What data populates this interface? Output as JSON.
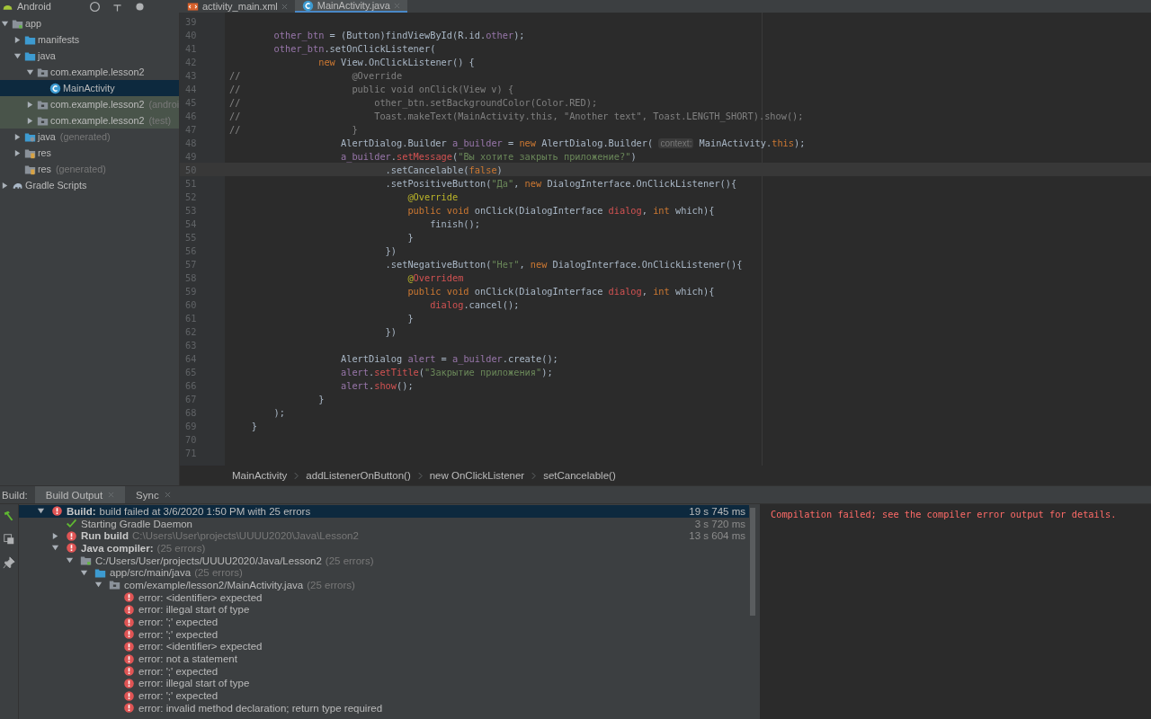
{
  "top_bar": {
    "view_mode": "Android"
  },
  "editor_tabs": [
    {
      "label": "activity_main.xml",
      "kind": "xml",
      "selected": false
    },
    {
      "label": "MainActivity.java",
      "kind": "class",
      "selected": true
    }
  ],
  "project_tree": [
    {
      "label": "app",
      "kind": "module",
      "expanded": true,
      "highlighted": false,
      "selected": false,
      "children": [
        {
          "label": "manifests",
          "kind": "folder",
          "expanded": false,
          "highlighted": false,
          "selected": false
        },
        {
          "label": "java",
          "kind": "folder",
          "expanded": true,
          "highlighted": false,
          "selected": false,
          "children": [
            {
              "label": "com.example.lesson2",
              "kind": "package",
              "expanded": true,
              "highlighted": false,
              "selected": false,
              "children": [
                {
                  "label": "MainActivity",
                  "kind": "class",
                  "highlighted": false,
                  "selected": true
                }
              ]
            },
            {
              "label": "com.example.lesson2",
              "note": "(androi",
              "kind": "package",
              "expanded": false,
              "highlighted": true,
              "selected": false
            },
            {
              "label": "com.example.lesson2",
              "note": "(test)",
              "kind": "package",
              "expanded": false,
              "highlighted": true,
              "selected": false
            }
          ]
        },
        {
          "label": "java",
          "note": "(generated)",
          "kind": "generated",
          "expanded": false,
          "highlighted": false,
          "selected": false
        },
        {
          "label": "res",
          "kind": "res",
          "expanded": false,
          "highlighted": false,
          "selected": false
        },
        {
          "label": "res",
          "note": "(generated)",
          "kind": "res",
          "highlighted": false,
          "selected": false
        }
      ]
    },
    {
      "label": "Gradle Scripts",
      "kind": "gradle",
      "expanded": false,
      "highlighted": false,
      "selected": false
    }
  ],
  "code_lines": [
    {
      "n": "39",
      "current": false
    },
    {
      "n": "40",
      "current": false,
      "tokens": [
        {
          "kind": "field",
          "text": "        other_btn"
        },
        {
          "kind": "plain",
          "text": " = (Button)findViewById(R.id."
        },
        {
          "kind": "field",
          "text": "other"
        },
        {
          "kind": "plain",
          "text": ");"
        }
      ]
    },
    {
      "n": "41",
      "current": false,
      "tokens": [
        {
          "kind": "field",
          "text": "        other_btn"
        },
        {
          "kind": "plain",
          "text": ".setOnClickListener("
        }
      ]
    },
    {
      "n": "42",
      "current": false,
      "tokens": [
        {
          "kind": "keyword",
          "text": "                new"
        },
        {
          "kind": "plain",
          "text": " View.OnClickListener() {"
        }
      ]
    },
    {
      "n": "43",
      "current": false,
      "tokens": [
        {
          "kind": "comment",
          "text": "//                    @Override"
        }
      ]
    },
    {
      "n": "44",
      "current": false,
      "tokens": [
        {
          "kind": "comment",
          "text": "//                    public void onClick(View v) {"
        }
      ]
    },
    {
      "n": "45",
      "current": false,
      "tokens": [
        {
          "kind": "comment",
          "text": "//                        other_btn.setBackgroundColor(Color.RED);"
        }
      ]
    },
    {
      "n": "46",
      "current": false,
      "tokens": [
        {
          "kind": "comment",
          "text": "//                        Toast.makeText(MainActivity.this, \"Another text\", Toast.LENGTH_SHORT).show();"
        }
      ]
    },
    {
      "n": "47",
      "current": false,
      "tokens": [
        {
          "kind": "comment",
          "text": "//                    }"
        }
      ]
    },
    {
      "n": "48",
      "current": false,
      "tokens": [
        {
          "kind": "plain",
          "text": "                    AlertDialog.Builder "
        },
        {
          "kind": "field",
          "text": "a_builder"
        },
        {
          "kind": "plain",
          "text": " = "
        },
        {
          "kind": "keyword",
          "text": "new"
        },
        {
          "kind": "plain",
          "text": " AlertDialog.Builder( "
        },
        {
          "kind": "hint",
          "text": "context:"
        },
        {
          "kind": "plain",
          "text": " MainActivity."
        },
        {
          "kind": "keyword",
          "text": "this"
        },
        {
          "kind": "plain",
          "text": ");"
        }
      ]
    },
    {
      "n": "49",
      "current": false,
      "tokens": [
        {
          "kind": "field",
          "text": "                    a_builder"
        },
        {
          "kind": "plain",
          "text": "."
        },
        {
          "kind": "error",
          "text": "setMessage"
        },
        {
          "kind": "plain",
          "text": "("
        },
        {
          "kind": "string",
          "text": "\"Вы хотите закрыть приложение?\""
        },
        {
          "kind": "plain",
          "text": ")"
        }
      ]
    },
    {
      "n": "50",
      "current": true,
      "tokens": [
        {
          "kind": "plain",
          "text": "                            .setCancelable("
        },
        {
          "kind": "keyword",
          "text": "false"
        },
        {
          "kind": "plain",
          "text": ")"
        }
      ]
    },
    {
      "n": "51",
      "current": false,
      "tokens": [
        {
          "kind": "plain",
          "text": "                            .setPositiveButton("
        },
        {
          "kind": "string",
          "text": "\"Да\""
        },
        {
          "kind": "plain",
          "text": ", "
        },
        {
          "kind": "keyword",
          "text": "new"
        },
        {
          "kind": "plain",
          "text": " DialogInterface.OnClickListener(){"
        }
      ]
    },
    {
      "n": "52",
      "current": false,
      "tokens": [
        {
          "kind": "annotation",
          "text": "                                @Override"
        }
      ]
    },
    {
      "n": "53",
      "current": false,
      "tokens": [
        {
          "kind": "keyword",
          "text": "                                public void"
        },
        {
          "kind": "plain",
          "text": " onClick(DialogInterface "
        },
        {
          "kind": "error",
          "text": "dialog"
        },
        {
          "kind": "plain",
          "text": ", "
        },
        {
          "kind": "keyword",
          "text": "int"
        },
        {
          "kind": "plain",
          "text": " which){"
        }
      ]
    },
    {
      "n": "54",
      "current": false,
      "tokens": [
        {
          "kind": "plain",
          "text": "                                    finish();"
        }
      ]
    },
    {
      "n": "55",
      "current": false,
      "tokens": [
        {
          "kind": "plain",
          "text": "                                }"
        }
      ]
    },
    {
      "n": "56",
      "current": false,
      "tokens": [
        {
          "kind": "plain",
          "text": "                            })"
        }
      ]
    },
    {
      "n": "57",
      "current": false,
      "tokens": [
        {
          "kind": "plain",
          "text": "                            .setNegativeButton("
        },
        {
          "kind": "string",
          "text": "\"Нет\""
        },
        {
          "kind": "plain",
          "text": ", "
        },
        {
          "kind": "keyword",
          "text": "new"
        },
        {
          "kind": "plain",
          "text": " DialogInterface.OnClickListener(){"
        }
      ]
    },
    {
      "n": "58",
      "current": false,
      "tokens": [
        {
          "kind": "annotation",
          "text": "                                @"
        },
        {
          "kind": "error",
          "text": "Overridem"
        }
      ]
    },
    {
      "n": "59",
      "current": false,
      "tokens": [
        {
          "kind": "keyword",
          "text": "                                public void"
        },
        {
          "kind": "plain",
          "text": " onClick(DialogInterface "
        },
        {
          "kind": "error",
          "text": "dialog"
        },
        {
          "kind": "plain",
          "text": ", "
        },
        {
          "kind": "keyword",
          "text": "int"
        },
        {
          "kind": "plain",
          "text": " which){"
        }
      ]
    },
    {
      "n": "60",
      "current": false,
      "tokens": [
        {
          "kind": "error",
          "text": "                                    dialog"
        },
        {
          "kind": "plain",
          "text": ".cancel();"
        }
      ]
    },
    {
      "n": "61",
      "current": false,
      "tokens": [
        {
          "kind": "plain",
          "text": "                                }"
        }
      ]
    },
    {
      "n": "62",
      "current": false,
      "tokens": [
        {
          "kind": "plain",
          "text": "                            })"
        }
      ]
    },
    {
      "n": "63",
      "current": false
    },
    {
      "n": "64",
      "current": false,
      "tokens": [
        {
          "kind": "plain",
          "text": "                    AlertDialog "
        },
        {
          "kind": "field",
          "text": "alert"
        },
        {
          "kind": "plain",
          "text": " = "
        },
        {
          "kind": "field",
          "text": "a_builder"
        },
        {
          "kind": "plain",
          "text": ".create();"
        }
      ]
    },
    {
      "n": "65",
      "current": false,
      "tokens": [
        {
          "kind": "field",
          "text": "                    alert"
        },
        {
          "kind": "plain",
          "text": "."
        },
        {
          "kind": "error",
          "text": "setTitle"
        },
        {
          "kind": "plain",
          "text": "("
        },
        {
          "kind": "string",
          "text": "\"Закрытие приложения\""
        },
        {
          "kind": "plain",
          "text": ");"
        }
      ]
    },
    {
      "n": "66",
      "current": false,
      "tokens": [
        {
          "kind": "field",
          "text": "                    alert"
        },
        {
          "kind": "plain",
          "text": "."
        },
        {
          "kind": "error",
          "text": "show"
        },
        {
          "kind": "plain",
          "text": "();"
        }
      ]
    },
    {
      "n": "67",
      "current": false,
      "tokens": [
        {
          "kind": "plain",
          "text": "                }"
        }
      ]
    },
    {
      "n": "68",
      "current": false,
      "tokens": [
        {
          "kind": "plain",
          "text": "        );"
        }
      ]
    },
    {
      "n": "69",
      "current": false,
      "tokens": [
        {
          "kind": "plain",
          "text": "    }"
        }
      ]
    },
    {
      "n": "70",
      "current": false
    },
    {
      "n": "71",
      "current": false
    }
  ],
  "breadcrumbs": [
    "MainActivity",
    "addListenerOnButton()",
    "new OnClickListener",
    "setCancelable()"
  ],
  "build_panel": {
    "label": "Build:",
    "tabs": [
      {
        "label": "Build Output",
        "selected": true
      },
      {
        "label": "Sync",
        "selected": false
      }
    ],
    "tree": [
      {
        "kind": "error",
        "bold": "Build:",
        "text": "build failed at 3/6/2020 1:50 PM  with 25 errors",
        "time": "19 s 745 ms",
        "expanded": true,
        "selected": true,
        "children": [
          {
            "kind": "ok",
            "text": "Starting Gradle Daemon",
            "time": "3 s 720 ms",
            "selected": false
          },
          {
            "kind": "error",
            "bold": "Run build",
            "note": "C:\\Users\\User\\projects\\UUUU2020\\Java\\Lesson2",
            "time": "13 s 604 ms",
            "expanded": false,
            "selected": false
          },
          {
            "kind": "error",
            "bold": "Java compiler:",
            "note": "(25 errors)",
            "expanded": true,
            "selected": false,
            "children": [
              {
                "kind": "module",
                "text": "C:/Users/User/projects/UUUU2020/Java/Lesson2",
                "note": "(25 errors)",
                "expanded": true,
                "selected": false,
                "children": [
                  {
                    "kind": "folder",
                    "text": "app/src/main/java",
                    "note": "(25 errors)",
                    "expanded": true,
                    "selected": false,
                    "children": [
                      {
                        "kind": "package",
                        "text": "com/example/lesson2/MainActivity.java",
                        "note": "(25 errors)",
                        "expanded": true,
                        "selected": false,
                        "children": [
                          {
                            "kind": "error",
                            "text": "error: <identifier> expected",
                            "selected": false
                          },
                          {
                            "kind": "error",
                            "text": "error: illegal start of type",
                            "selected": false
                          },
                          {
                            "kind": "error",
                            "text": "error: ';' expected",
                            "selected": false
                          },
                          {
                            "kind": "error",
                            "text": "error: ';' expected",
                            "selected": false
                          },
                          {
                            "kind": "error",
                            "text": "error: <identifier> expected",
                            "selected": false
                          },
                          {
                            "kind": "error",
                            "text": "error: not a statement",
                            "selected": false
                          },
                          {
                            "kind": "error",
                            "text": "error: ';' expected",
                            "selected": false
                          },
                          {
                            "kind": "error",
                            "text": "error: illegal start of type",
                            "selected": false
                          },
                          {
                            "kind": "error",
                            "text": "error: ';' expected",
                            "selected": false
                          },
                          {
                            "kind": "error",
                            "text": "error: invalid method declaration; return type required",
                            "selected": false
                          }
                        ]
                      }
                    ]
                  }
                ]
              }
            ]
          }
        ]
      }
    ],
    "console": "Compilation failed; see the compiler error output for details."
  }
}
